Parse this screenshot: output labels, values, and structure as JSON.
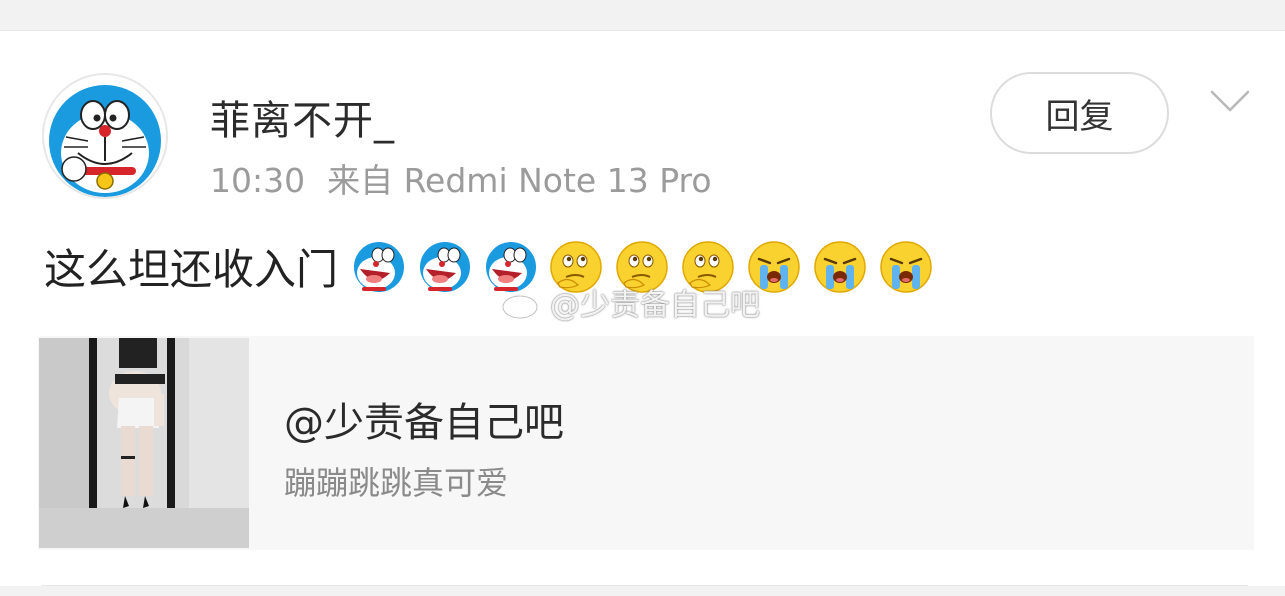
{
  "post": {
    "username": "菲离不开_",
    "time": "10:30",
    "source": "来自 Redmi Note 13 Pro",
    "reply_label": "回复",
    "text": "这么坦还收入门",
    "emojis": [
      "doraemon-laugh",
      "doraemon-laugh",
      "doraemon-laugh",
      "thinking",
      "thinking",
      "thinking",
      "crying",
      "crying",
      "crying"
    ]
  },
  "watermark": {
    "text": "@少责备自己吧"
  },
  "card": {
    "title": "@少责备自己吧",
    "subtitle": "蹦蹦跳跳真可爱"
  }
}
